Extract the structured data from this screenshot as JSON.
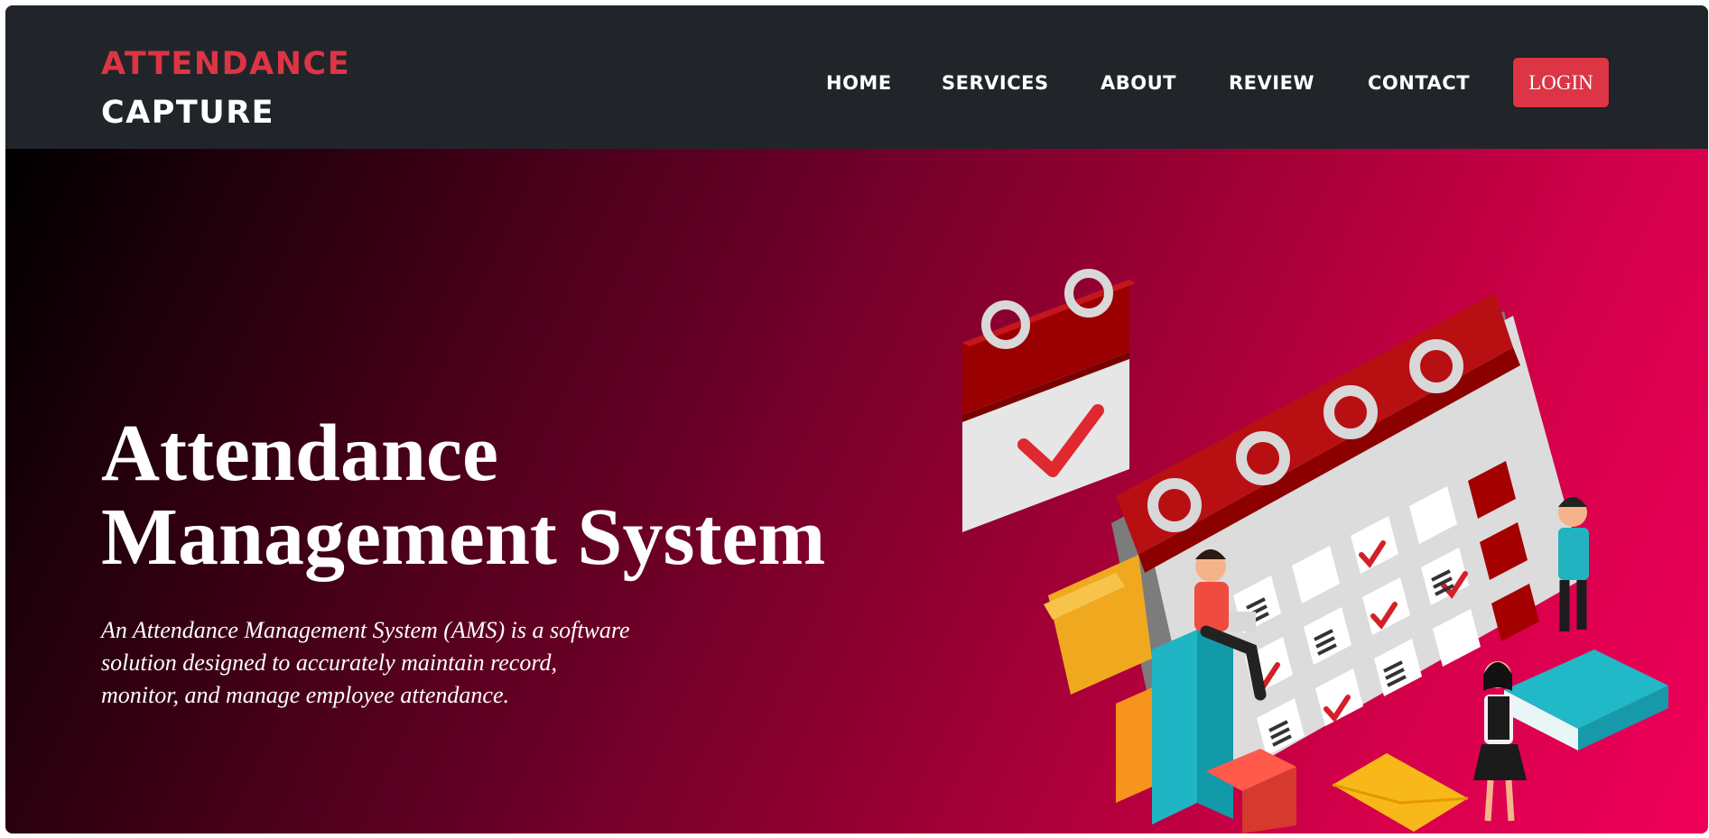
{
  "brand": {
    "line1": "ATTENDANCE",
    "line2": "CAPTURE"
  },
  "nav": {
    "items": [
      {
        "label": "HOME"
      },
      {
        "label": "SERVICES"
      },
      {
        "label": "ABOUT"
      },
      {
        "label": "REVIEW"
      },
      {
        "label": "CONTACT"
      }
    ],
    "login_label": "LOGIN"
  },
  "hero": {
    "title_lines": [
      "Attendance",
      "Management System"
    ],
    "description_lines": [
      "An Attendance Management System (AMS) is a software",
      "solution designed to accurately maintain record,",
      "monitor, and manage employee attendance."
    ]
  },
  "colors": {
    "navbar_bg": "#212529",
    "accent_red": "#dc3545",
    "hero_gradient_start": "#000000",
    "hero_gradient_end": "#f0005a",
    "text_white": "#ffffff"
  },
  "illustration": {
    "icon": "calendar-attendance-illustration"
  }
}
